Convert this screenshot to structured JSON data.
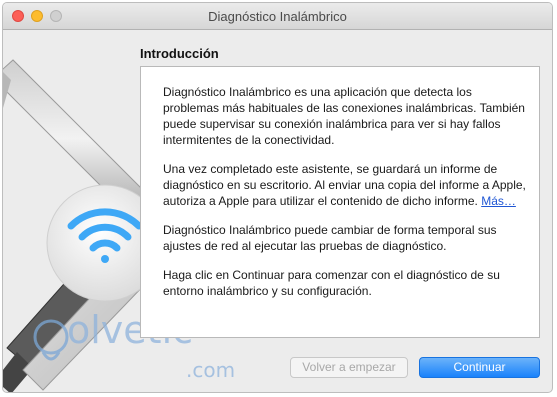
{
  "window": {
    "title": "Diagnóstico Inalámbrico"
  },
  "section": {
    "heading": "Introducción"
  },
  "content": {
    "paragraph_1": "Diagnóstico Inalámbrico es una aplicación que detecta los problemas más habituales de las conexiones inalámbricas. También puede supervisar su conexión inalámbrica para ver si hay fallos intermitentes de la conectividad.",
    "paragraph_2": "Una vez completado este asistente, se guardará un informe de diagnóstico en su escritorio. Al enviar una copia del informe a Apple, autoriza a Apple para utilizar el contenido de dicho informe.",
    "more_link": "Más…",
    "paragraph_3": "Diagnóstico Inalámbrico puede cambiar de forma temporal sus ajustes de red al ejecutar las pruebas de diagnóstico.",
    "paragraph_4": "Haga clic en Continuar para comenzar con el diagnóstico de su entorno inalámbrico y su configuración."
  },
  "buttons": {
    "back_label": "Volver a empezar",
    "continue_label": "Continuar"
  },
  "watermark": {
    "text": "olvetic",
    "suffix": ".com"
  },
  "colors": {
    "accent": "#1a82fb",
    "wifi": "#3ea8f6",
    "link": "#1f56d4"
  }
}
